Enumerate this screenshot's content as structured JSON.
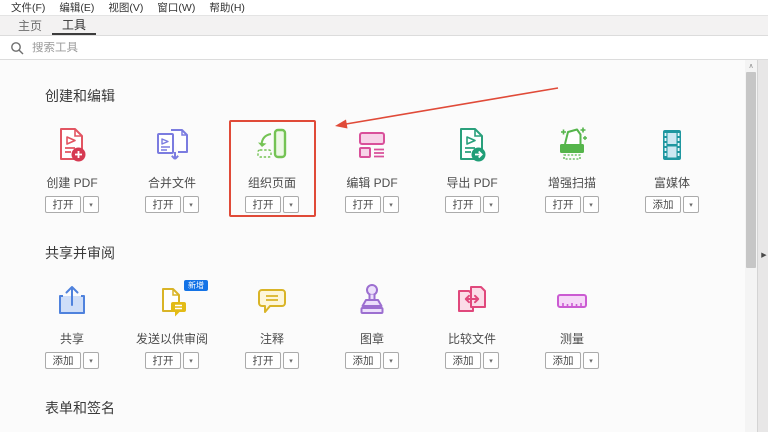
{
  "menu_bar": {
    "items": [
      {
        "label": "文件(F)"
      },
      {
        "label": "编辑(E)"
      },
      {
        "label": "视图(V)"
      },
      {
        "label": "窗口(W)"
      },
      {
        "label": "帮助(H)"
      }
    ]
  },
  "tabs": [
    {
      "label": "主页",
      "active": false
    },
    {
      "label": "工具",
      "active": true
    }
  ],
  "search": {
    "placeholder": "搜索工具",
    "icon": "search-icon"
  },
  "sections": [
    {
      "title": "创建和编辑",
      "tools": [
        {
          "label": "创建 PDF",
          "button": "打开",
          "icon": "create-pdf-icon"
        },
        {
          "label": "合并文件",
          "button": "打开",
          "icon": "combine-files-icon"
        },
        {
          "label": "组织页面",
          "button": "打开",
          "icon": "organize-pages-icon",
          "highlighted": true
        },
        {
          "label": "编辑 PDF",
          "button": "打开",
          "icon": "edit-pdf-icon"
        },
        {
          "label": "导出 PDF",
          "button": "打开",
          "icon": "export-pdf-icon"
        },
        {
          "label": "增强扫描",
          "button": "打开",
          "icon": "enhance-scans-icon"
        },
        {
          "label": "富媒体",
          "button": "添加",
          "icon": "rich-media-icon"
        }
      ]
    },
    {
      "title": "共享并审阅",
      "tools": [
        {
          "label": "共享",
          "button": "添加",
          "icon": "share-icon"
        },
        {
          "label": "发送以供审阅",
          "button": "打开",
          "icon": "send-for-review-icon",
          "badge": "新增"
        },
        {
          "label": "注释",
          "button": "打开",
          "icon": "comment-icon"
        },
        {
          "label": "图章",
          "button": "添加",
          "icon": "stamp-icon"
        },
        {
          "label": "比较文件",
          "button": "添加",
          "icon": "compare-files-icon"
        },
        {
          "label": "测量",
          "button": "添加",
          "icon": "measure-icon"
        }
      ]
    },
    {
      "title": "表单和签名",
      "tools": []
    }
  ],
  "annotation": {
    "type": "red-box-and-arrow",
    "target": "组织页面",
    "color": "#e04a38"
  },
  "ui": {
    "dropdown_caret": "▾",
    "scroll_up_glyph": "∧",
    "panel_expand_glyph": "▶"
  }
}
